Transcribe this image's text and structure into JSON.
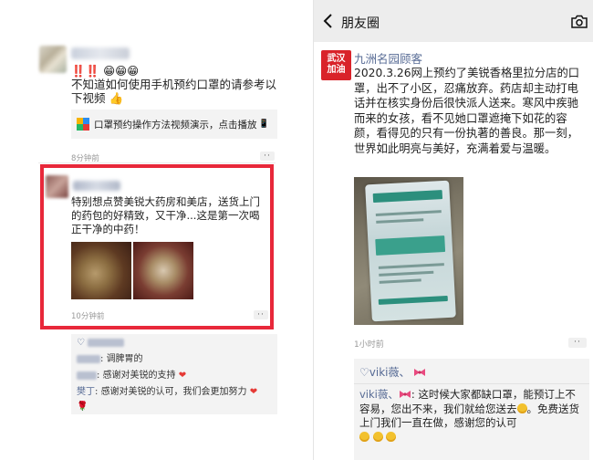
{
  "left_panel": {
    "post1": {
      "alerts": "‼️‼️",
      "text": "不知道如何使用手机预约口罩的请参考以下视频",
      "share_card_text": "口罩预约操作方法视频演示，点击播放",
      "time": "8分钟前"
    },
    "post2": {
      "text": "特别想点赞美锐大药房和美店，送货上门的药包的好精致，又干净...这是第一次喝正干净的中药！",
      "time": "10分钟前"
    },
    "comments": [
      {
        "name": "",
        "text": "调脾胃的"
      },
      {
        "name": "",
        "text": "感谢对美锐的支持"
      },
      {
        "name": "樊丁",
        "text": "感谢对美锐的认可，我们会更加努力"
      }
    ]
  },
  "right_panel": {
    "nav": {
      "title": "朋友圈",
      "back_icon": "chevron-left-icon",
      "camera_icon": "camera-icon"
    },
    "logo_text": "武汉加油",
    "poster_name": "九洲名园顾客",
    "post_text": "2020.3.26网上预约了美锐香格里拉分店的口罩，出不了小区，忍痛放弃。药店却主动打电话并在核实身份后很快派人送来。寒风中疾驰而来的女孩，看不见她口罩遮掩下如花的容颜，看得见的只有一份执著的善良。那一刻，世界如此明亮与美好，充满着爱与温暖。",
    "time": "1小时前",
    "likes": "♡viki薇、",
    "reply": {
      "name": "viki薇、",
      "text": ": 这时候大家都缺口罩，能预订上不容易，您出不来，我们就给您送去",
      "text2": "。免费送货上门我们一直在做，感谢您的认可"
    },
    "colors": {
      "link": "#576b95",
      "red_box": "#e8283a",
      "logo_bg": "#d9232a"
    }
  }
}
